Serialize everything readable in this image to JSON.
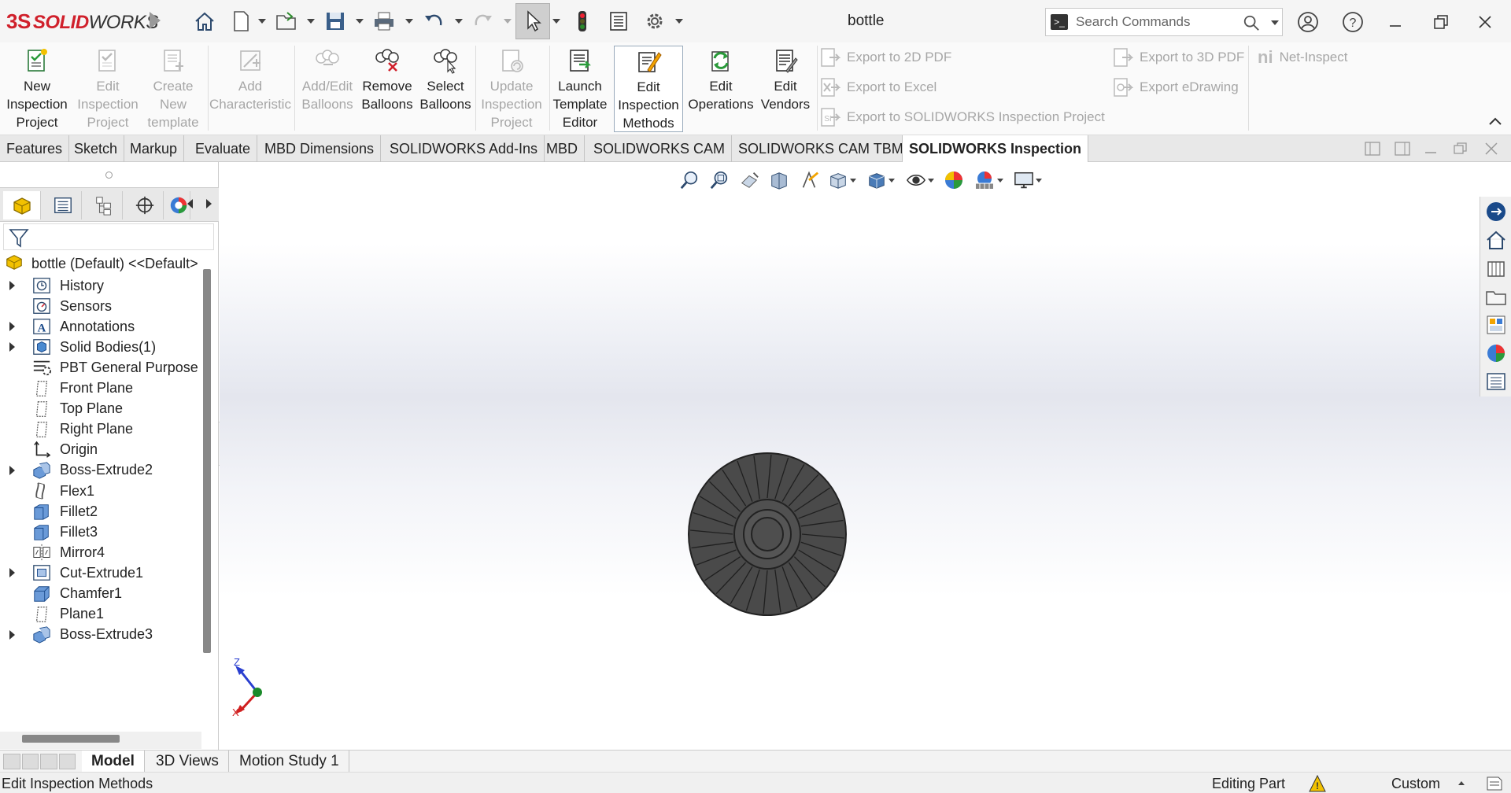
{
  "app": {
    "brand_prefix": "3S",
    "brand_solid": "SOLID",
    "brand_works": "WORKS",
    "document_title": "bottle"
  },
  "search": {
    "placeholder": "Search Commands"
  },
  "quick_access": [
    "home-icon",
    "new-document-icon",
    "open-icon",
    "save-icon",
    "print-icon",
    "undo-icon",
    "redo-icon",
    "select-pointer-icon",
    "rebuild-icon",
    "file-properties-icon",
    "options-gear-icon"
  ],
  "ribbon": {
    "buttons": [
      {
        "l1": "New",
        "l2": "Inspection",
        "l3": "Project",
        "enabled": true
      },
      {
        "l1": "Edit",
        "l2": "Inspection",
        "l3": "Project",
        "enabled": false
      },
      {
        "l1": "Create",
        "l2": "New",
        "l3": "template",
        "enabled": false
      },
      {
        "l1": "Add",
        "l2": "Characteristic",
        "l3": "",
        "enabled": false
      },
      {
        "l1": "Add/Edit",
        "l2": "Balloons",
        "l3": "",
        "enabled": false
      },
      {
        "l1": "Remove",
        "l2": "Balloons",
        "l3": "",
        "enabled": true
      },
      {
        "l1": "Select",
        "l2": "Balloons",
        "l3": "",
        "enabled": true
      },
      {
        "l1": "Update",
        "l2": "Inspection",
        "l3": "Project",
        "enabled": false
      },
      {
        "l1": "Launch",
        "l2": "Template",
        "l3": "Editor",
        "enabled": true
      },
      {
        "l1": "Edit",
        "l2": "Inspection",
        "l3": "Methods",
        "enabled": true,
        "active": true
      },
      {
        "l1": "Edit",
        "l2": "Operations",
        "l3": "",
        "enabled": true
      },
      {
        "l1": "Edit",
        "l2": "Vendors",
        "l3": "",
        "enabled": true
      }
    ],
    "exports_col1": [
      "Export to 2D PDF",
      "Export to Excel",
      "Export to SOLIDWORKS Inspection Project"
    ],
    "exports_col2": [
      "Export to 3D PDF",
      "Export eDrawing"
    ],
    "net_inspect": "Net-Inspect"
  },
  "command_tabs": [
    "Features",
    "Sketch",
    "Markup",
    "Evaluate",
    "MBD Dimensions",
    "SOLIDWORKS Add-Ins",
    "MBD",
    "SOLIDWORKS CAM",
    "SOLIDWORKS CAM TBM",
    "SOLIDWORKS Inspection"
  ],
  "active_command_tab": "SOLIDWORKS Inspection",
  "feature_tree": {
    "root": "bottle (Default) <<Default>",
    "items": [
      {
        "label": "History",
        "icon": "history-icon",
        "expandable": true
      },
      {
        "label": "Sensors",
        "icon": "sensors-icon",
        "expandable": false
      },
      {
        "label": "Annotations",
        "icon": "annotations-icon",
        "expandable": true
      },
      {
        "label": "Solid Bodies(1)",
        "icon": "solid-bodies-icon",
        "expandable": true
      },
      {
        "label": "PBT General Purpose",
        "icon": "material-icon",
        "expandable": false
      },
      {
        "label": "Front Plane",
        "icon": "plane-icon",
        "expandable": false
      },
      {
        "label": "Top Plane",
        "icon": "plane-icon",
        "expandable": false
      },
      {
        "label": "Right Plane",
        "icon": "plane-icon",
        "expandable": false
      },
      {
        "label": "Origin",
        "icon": "origin-icon",
        "expandable": false
      },
      {
        "label": "Boss-Extrude2",
        "icon": "boss-extrude-icon",
        "expandable": true
      },
      {
        "label": "Flex1",
        "icon": "flex-icon",
        "expandable": false
      },
      {
        "label": "Fillet2",
        "icon": "fillet-icon",
        "expandable": false
      },
      {
        "label": "Fillet3",
        "icon": "fillet-icon",
        "expandable": false
      },
      {
        "label": "Mirror4",
        "icon": "mirror-icon",
        "expandable": false
      },
      {
        "label": "Cut-Extrude1",
        "icon": "cut-extrude-icon",
        "expandable": true
      },
      {
        "label": "Chamfer1",
        "icon": "chamfer-icon",
        "expandable": false
      },
      {
        "label": "Plane1",
        "icon": "plane-icon",
        "expandable": false
      },
      {
        "label": "Boss-Extrude3",
        "icon": "boss-extrude-icon",
        "expandable": true
      }
    ]
  },
  "triad": {
    "z": "Z",
    "x": "X"
  },
  "bottom_tabs": [
    "Model",
    "3D Views",
    "Motion Study 1"
  ],
  "active_bottom_tab": "Model",
  "status": {
    "left": "Edit Inspection Methods",
    "mode": "Editing Part",
    "units": "Custom"
  },
  "colors": {
    "brand_red": "#d0202b",
    "part_gray": "#4a4a4a",
    "accent_blue": "#2a62b8"
  }
}
